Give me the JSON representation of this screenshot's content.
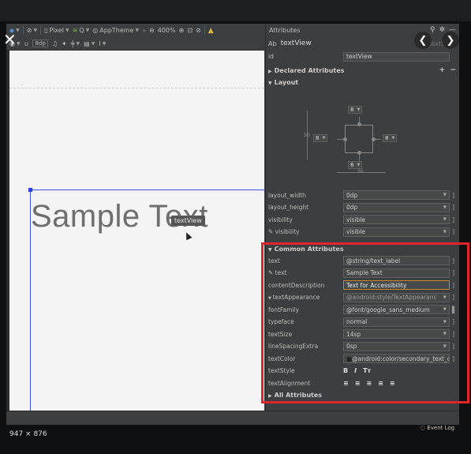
{
  "toolbar": {
    "device": "Pixel",
    "api": "Q",
    "theme": "AppTheme",
    "zoom": "400%",
    "margin": "8dp",
    "more": "»"
  },
  "canvas": {
    "sample_text": "Sample Text",
    "tooltip": "textView"
  },
  "panel": {
    "title": "Attributes",
    "component_name": "textView",
    "component_prefix": "Ab",
    "component_ghost": "TextView",
    "id_label": "id",
    "id_value": "textView",
    "declared_section": "Declared Attributes",
    "layout_section": "Layout",
    "constraint_values": {
      "top": "8",
      "left": "8",
      "right": "8",
      "bottom": "8"
    },
    "bias_label": "50",
    "layout_rows": [
      {
        "label": "layout_width",
        "value": "0dp"
      },
      {
        "label": "layout_height",
        "value": "0dp"
      },
      {
        "label": "visibility",
        "value": "visible"
      },
      {
        "label": "visibility",
        "value": "visible",
        "tool": true
      }
    ],
    "common_section": "Common Attributes",
    "common_rows": [
      {
        "label": "text",
        "value": "@string/text_label"
      },
      {
        "label": "text",
        "value": "Sample Text",
        "tool": true
      },
      {
        "label": "contentDescription",
        "value": "Text for Accessibility"
      },
      {
        "label": "textAppearance",
        "value": "@android:style/TextAppearanc"
      },
      {
        "label": "fontFamily",
        "value": "@font/google_sans_medium"
      },
      {
        "label": "typeface",
        "value": "normal"
      },
      {
        "label": "textSize",
        "value": "14sp"
      },
      {
        "label": "lineSpacingExtra",
        "value": "0sp"
      },
      {
        "label": "textColor",
        "value": "@android:color/secondary_text_c"
      },
      {
        "label": "textStyle",
        "value": ""
      },
      {
        "label": "textAlignment",
        "value": ""
      }
    ],
    "text_style_icons": [
      "B",
      "I",
      "Tт"
    ],
    "all_section": "All Attributes"
  },
  "overlay": {
    "dimensions": "947 × 876",
    "event_log": "Event Log"
  },
  "colors": {
    "accent_red": "#e0262a",
    "selection_blue": "#3c50e6",
    "focus_orange": "#c08a2c"
  }
}
